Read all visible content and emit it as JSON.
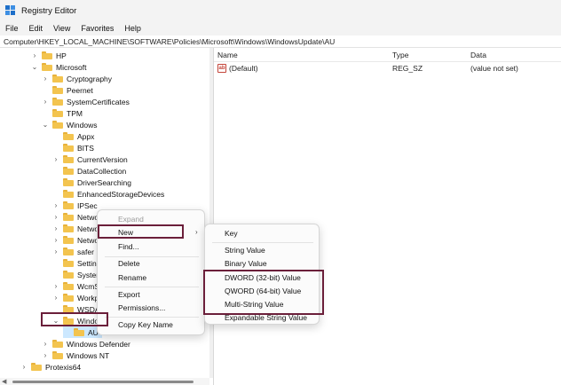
{
  "window": {
    "title": "Registry Editor"
  },
  "menu": [
    "File",
    "Edit",
    "View",
    "Favorites",
    "Help"
  ],
  "address": "Computer\\HKEY_LOCAL_MACHINE\\SOFTWARE\\Policies\\Microsoft\\Windows\\WindowsUpdate\\AU",
  "tree": [
    {
      "label": "HP",
      "chevron": ">"
    },
    {
      "label": "Microsoft",
      "chevron": "v"
    },
    {
      "label": "Cryptography",
      "chevron": ">"
    },
    {
      "label": "Peernet",
      "chevron": ""
    },
    {
      "label": "SystemCertificates",
      "chevron": ">"
    },
    {
      "label": "TPM",
      "chevron": ""
    },
    {
      "label": "Windows",
      "chevron": "v"
    },
    {
      "label": "Appx",
      "chevron": ""
    },
    {
      "label": "BITS",
      "chevron": ""
    },
    {
      "label": "CurrentVersion",
      "chevron": ">"
    },
    {
      "label": "DataCollection",
      "chevron": ""
    },
    {
      "label": "DriverSearching",
      "chevron": ""
    },
    {
      "label": "EnhancedStorageDevices",
      "chevron": ""
    },
    {
      "label": "IPSec",
      "chevron": ">"
    },
    {
      "label": "Netwo",
      "chevron": ">"
    },
    {
      "label": "Netwo",
      "chevron": ">"
    },
    {
      "label": "Netwo",
      "chevron": ">"
    },
    {
      "label": "safer",
      "chevron": ">"
    },
    {
      "label": "Setting",
      "chevron": ""
    },
    {
      "label": "Systen",
      "chevron": ""
    },
    {
      "label": "WcmSv",
      "chevron": ">"
    },
    {
      "label": "Workp",
      "chevron": ">"
    },
    {
      "label": "WSDA",
      "chevron": ""
    },
    {
      "label": "Windo",
      "chevron": "v"
    },
    {
      "label": "AU",
      "chevron": ""
    },
    {
      "label": "Windows Defender",
      "chevron": ">"
    },
    {
      "label": "Windows NT",
      "chevron": ">"
    },
    {
      "label": "Protexis64",
      "chevron": ">"
    }
  ],
  "list": {
    "headers": {
      "name": "Name",
      "type": "Type",
      "data": "Data"
    },
    "rows": [
      {
        "name": "(Default)",
        "type": "REG_SZ",
        "data": "(value not set)",
        "icon": "ab-icon"
      }
    ]
  },
  "context_menu": {
    "expand": "Expand",
    "new": "New",
    "find": "Find...",
    "delete": "Delete",
    "rename": "Rename",
    "export": "Export",
    "permissions": "Permissions...",
    "copy_key_name": "Copy Key Name"
  },
  "submenu": {
    "key": "Key",
    "string_value": "String Value",
    "binary_value": "Binary Value",
    "dword": "DWORD (32-bit) Value",
    "qword": "QWORD (64-bit) Value",
    "multi_string": "Multi-String Value",
    "expandable": "Expandable String Value"
  },
  "colors": {
    "highlight": "#6b1f3a",
    "folder": "#f3c44f",
    "selected_row": "#cce8ff"
  }
}
